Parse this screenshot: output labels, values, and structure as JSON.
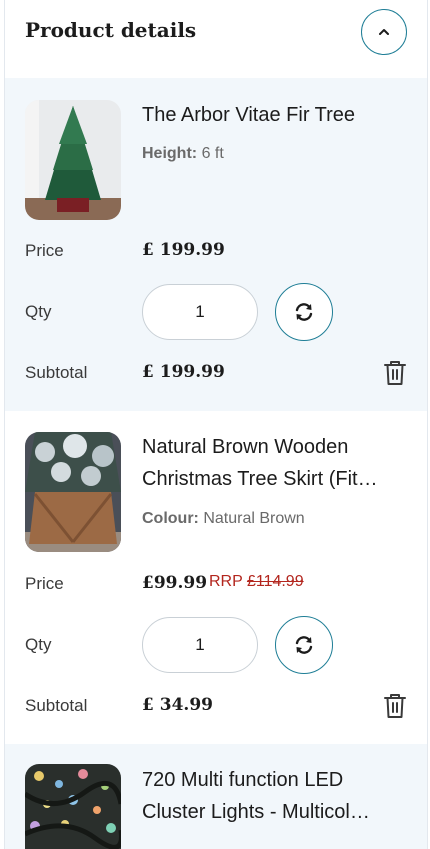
{
  "header": {
    "title": "Product details",
    "collapse_icon": "chevron-up-icon"
  },
  "items": [
    {
      "name": "The Arbor Vitae Fir Tree",
      "attr_label": "Height:",
      "attr_value": "6 ft",
      "price_label": "Price",
      "price": "£ 199.99",
      "qty_label": "Qty",
      "qty": "1",
      "subtotal_label": "Subtotal",
      "subtotal": "£ 199.99"
    },
    {
      "name": "Natural Brown Wooden Christmas Tree Skirt (Fit…",
      "attr_label": "Colour:",
      "attr_value": "Natural Brown",
      "price_label": "Price",
      "price": "£99.99",
      "rrp_label": "RRP",
      "rrp_value": "£114.99",
      "qty_label": "Qty",
      "qty": "1",
      "subtotal_label": "Subtotal",
      "subtotal": "£ 34.99"
    },
    {
      "name": "720 Multi function LED Cluster Lights - Multicol…"
    }
  ],
  "colors": {
    "accent": "#1f7e96",
    "rrp": "#b3261e",
    "alt_bg": "#f2f7fb"
  }
}
